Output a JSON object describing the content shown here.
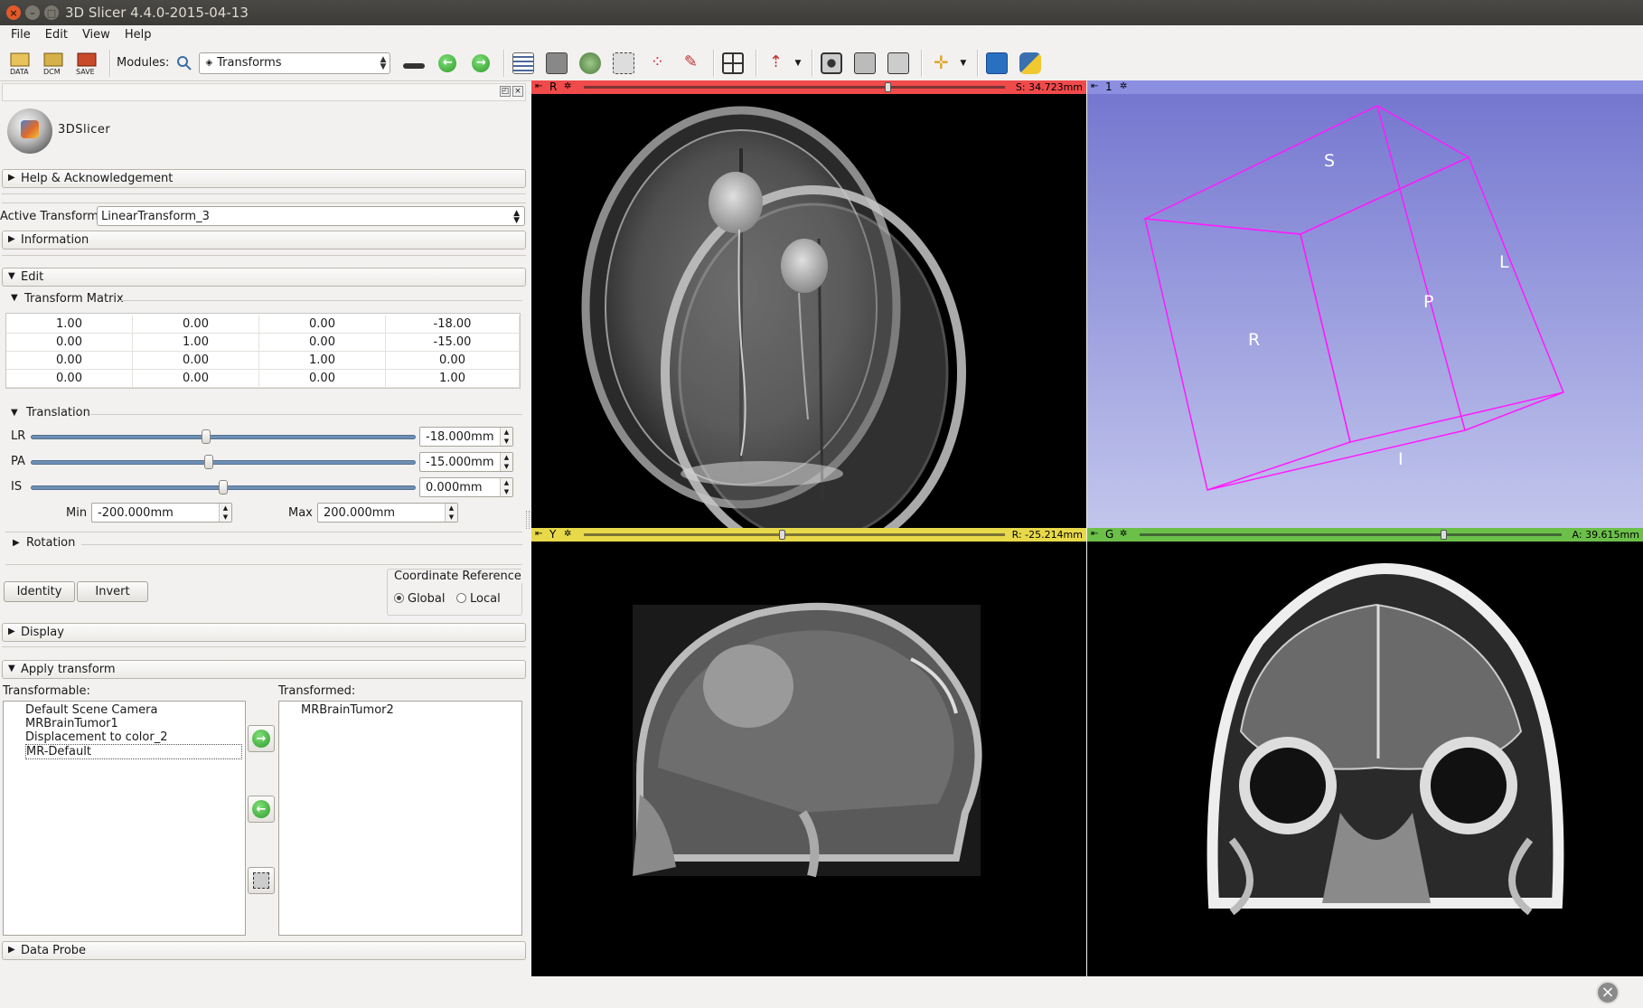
{
  "window": {
    "title": "3D Slicer 4.4.0-2015-04-13"
  },
  "menu": [
    "File",
    "Edit",
    "View",
    "Help"
  ],
  "toolbar": {
    "data_label": "DATA",
    "dcm_label": "DCM",
    "save_label": "SAVE",
    "modules_label": "Modules:",
    "module_selected": "Transforms"
  },
  "panel": {
    "logo_text": "3DSlicer",
    "help_section": "Help & Acknowledgement",
    "active_transform_label": "Active Transform:",
    "active_transform_value": "LinearTransform_3",
    "information_section": "Information",
    "edit_section": "Edit",
    "transform_matrix_label": "Transform Matrix",
    "matrix": [
      [
        "1.00",
        "0.00",
        "0.00",
        "-18.00"
      ],
      [
        "0.00",
        "1.00",
        "0.00",
        "-15.00"
      ],
      [
        "0.00",
        "0.00",
        "1.00",
        "0.00"
      ],
      [
        "0.00",
        "0.00",
        "0.00",
        "1.00"
      ]
    ],
    "translation_label": "Translation",
    "translation": [
      {
        "axis": "LR",
        "value": "-18.000mm",
        "position": 0.455
      },
      {
        "axis": "PA",
        "value": "-15.000mm",
        "position": 0.463
      },
      {
        "axis": "IS",
        "value": "0.000mm",
        "position": 0.5
      }
    ],
    "min_label": "Min",
    "min_value": "-200.000mm",
    "max_label": "Max",
    "max_value": "200.000mm",
    "rotation_label": "Rotation",
    "identity_button": "Identity",
    "invert_button": "Invert",
    "coordinate_reference_label": "Coordinate Reference",
    "global_label": "Global",
    "local_label": "Local",
    "display_section": "Display",
    "apply_section": "Apply transform",
    "transformable_label": "Transformable:",
    "transformable_items": [
      "Default Scene Camera",
      "MRBrainTumor1",
      "Displacement to color_2",
      "MR-Default"
    ],
    "transformed_label": "Transformed:",
    "transformed_items": [
      "MRBrainTumor2"
    ],
    "data_probe_section": "Data Probe"
  },
  "views": {
    "red": {
      "letter": "R",
      "value": "S: 34.723mm",
      "color": "#f04a4a",
      "slider": 0.72
    },
    "threed": {
      "letter": "1",
      "color": "#8c8fe0",
      "labels": [
        "S",
        "L",
        "P",
        "R",
        "I"
      ]
    },
    "yellow": {
      "letter": "Y",
      "value": "R: -25.214mm",
      "color": "#e8d94a",
      "slider": 0.47
    },
    "green": {
      "letter": "G",
      "value": "A: 39.615mm",
      "color": "#6cc04a",
      "slider": 0.72
    }
  }
}
